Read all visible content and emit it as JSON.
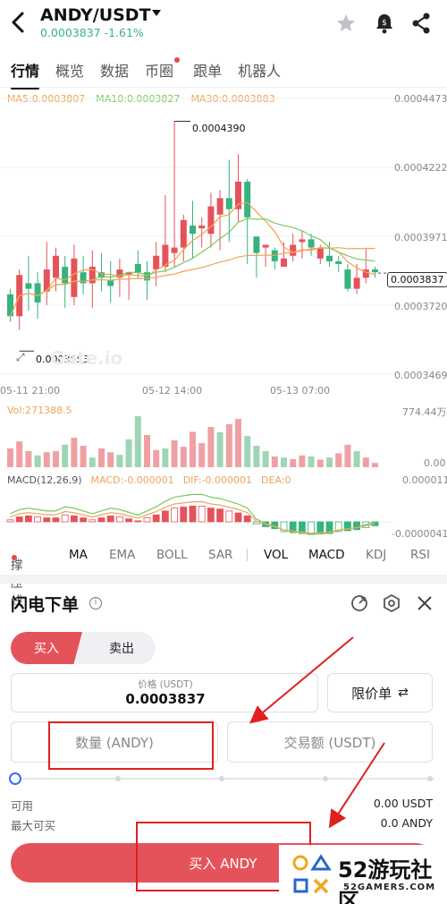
{
  "header": {
    "pair": "ANDY/USDT",
    "price_change": "0.0003837 -1.61%"
  },
  "tabs": [
    {
      "label": "行情"
    },
    {
      "label": "概览"
    },
    {
      "label": "数据"
    },
    {
      "label": "币圈"
    },
    {
      "label": "跟单"
    },
    {
      "label": "机器人"
    }
  ],
  "ma_legend": {
    "ma5": "MA5:0.0003807",
    "ma10": "MA10:0.0003827",
    "ma30": "MA30:0.0003883",
    "colors": {
      "ma5": "#f2a14d",
      "ma10": "#79c95f",
      "ma30": "#f0a35a"
    }
  },
  "chart_axis": {
    "y_labels": [
      "0.0004473",
      "0.0004222",
      "0.0003971",
      "0.0003720",
      "0.0003469"
    ],
    "x_labels": [
      "05-11 21:00",
      "05-12 14:00",
      "05-13 07:00"
    ],
    "current_price": "0.0003837",
    "high_label": "0.0004390",
    "low_label": "0.0003553",
    "watermark": "Gate.io"
  },
  "volume": {
    "label": "Vol:271388.5",
    "max_label": "774.44万",
    "zero_label": "0.00"
  },
  "macd": {
    "label": "MACD(12,26,9)",
    "macd_val": "MACD:-0.000001",
    "dif_val": "DIF:-0.000001",
    "dea_val": "DEA:0",
    "top_label": "0.0000112",
    "bottom_label": "-0.0000041"
  },
  "indicator_tabs": [
    "撑压线",
    "MA",
    "EMA",
    "BOLL",
    "SAR",
    "VOL",
    "MACD",
    "KDJ",
    "RSI"
  ],
  "order_panel": {
    "title": "闪电下单",
    "buy_tab": "买入",
    "sell_tab": "卖出",
    "price_label": "价格 (USDT)",
    "price_value": "0.0003837",
    "order_type": "限价单",
    "quantity_placeholder": "数量 (ANDY)",
    "amount_placeholder": "交易额 (USDT)",
    "available_label": "可用",
    "available_value": "0.00 USDT",
    "max_buy_label": "最大可买",
    "max_buy_value": "0.0 ANDY",
    "buy_button": "买入 ANDY"
  },
  "watermark_logo": {
    "big": "52游玩社区",
    "small": "52GAMERS.COM"
  },
  "chart_data": {
    "type": "candlestick",
    "ylim": [
      0.0003469,
      0.0004473
    ],
    "y_ticks": [
      0.0004473,
      0.0004222,
      0.0003971,
      0.000372,
      0.0003469
    ],
    "x_ticks": [
      "05-11 21:00",
      "05-12 14:00",
      "05-13 07:00"
    ],
    "candles": [
      [
        0.000376,
        0.000368,
        0.000378,
        0.000366
      ],
      [
        0.000368,
        0.000383,
        0.000385,
        0.000363
      ],
      [
        0.00038,
        0.000378,
        0.00039,
        0.00037
      ],
      [
        0.00038,
        0.000373,
        0.000384,
        0.000367
      ],
      [
        0.000377,
        0.000385,
        0.000395,
        0.000372
      ],
      [
        0.000382,
        0.00039,
        0.000393,
        0.000377
      ],
      [
        0.000386,
        0.00038,
        0.00039,
        0.000371
      ],
      [
        0.000375,
        0.000389,
        0.000394,
        0.000372
      ],
      [
        0.000384,
        0.00038,
        0.00039,
        0.000376
      ],
      [
        0.00038,
        0.000386,
        0.000392,
        0.000371
      ],
      [
        0.000384,
        0.000382,
        0.000391,
        0.000377
      ],
      [
        0.000381,
        0.000379,
        0.000388,
        0.000373
      ],
      [
        0.000382,
        0.000385,
        0.000389,
        0.000375
      ],
      [
        0.000383,
        0.000384,
        0.000384,
        0.000374
      ],
      [
        0.000387,
        0.000384,
        0.000392,
        0.000382
      ],
      [
        0.000384,
        0.000381,
        0.000388,
        0.000374
      ],
      [
        0.000385,
        0.00039,
        0.000395,
        0.000379
      ],
      [
        0.000386,
        0.000394,
        0.000412,
        0.000384
      ],
      [
        0.000391,
        0.000393,
        0.000439,
        0.000386
      ],
      [
        0.000393,
        0.000403,
        0.000405,
        0.000388
      ],
      [
        0.000401,
        0.000398,
        0.00041,
        0.000389
      ],
      [
        0.0004,
        0.000401,
        0.000404,
        0.000393
      ],
      [
        0.000398,
        0.000408,
        0.000413,
        0.000393
      ],
      [
        0.000405,
        0.000411,
        0.000414,
        0.000392
      ],
      [
        0.000411,
        0.000407,
        0.000425,
        0.000395
      ],
      [
        0.000407,
        0.000417,
        0.000427,
        0.000402
      ],
      [
        0.000417,
        0.000404,
        0.000418,
        0.000387
      ],
      [
        0.000397,
        0.000391,
        0.000397,
        0.000382
      ],
      [
        0.000393,
        0.000394,
        0.000394,
        0.000386
      ],
      [
        0.000392,
        0.000388,
        0.000393,
        0.000385
      ],
      [
        0.000386,
        0.000389,
        0.000395,
        0.000387
      ],
      [
        0.00039,
        0.000394,
        0.000398,
        0.000388
      ],
      [
        0.000395,
        0.000396,
        0.000399,
        0.000389
      ],
      [
        0.000396,
        0.000393,
        0.000398,
        0.00039
      ],
      [
        0.000389,
        0.000393,
        0.000394,
        0.000387
      ],
      [
        0.00039,
        0.000388,
        0.000395,
        0.000386
      ],
      [
        0.000388,
        0.000387,
        0.00039,
        0.000384
      ],
      [
        0.000385,
        0.000378,
        0.000387,
        0.000377
      ],
      [
        0.000378,
        0.000382,
        0.000387,
        0.000376
      ],
      [
        0.000382,
        0.000385,
        0.000393,
        0.00038
      ],
      [
        0.000385,
        0.000384,
        0.000386,
        0.000382
      ]
    ],
    "volume_max": 7744400,
    "volume_bars": [
      [
        0.35,
        "u"
      ],
      [
        0.48,
        "u"
      ],
      [
        0.3,
        "u"
      ],
      [
        0.22,
        "d"
      ],
      [
        0.28,
        "u"
      ],
      [
        0.3,
        "u"
      ],
      [
        0.42,
        "d"
      ],
      [
        0.55,
        "u"
      ],
      [
        0.4,
        "u"
      ],
      [
        0.18,
        "d"
      ],
      [
        0.35,
        "u"
      ],
      [
        0.28,
        "u"
      ],
      [
        0.23,
        "d"
      ],
      [
        0.52,
        "d"
      ],
      [
        0.95,
        "d"
      ],
      [
        0.6,
        "u"
      ],
      [
        0.32,
        "u"
      ],
      [
        0.35,
        "d"
      ],
      [
        0.5,
        "u"
      ],
      [
        0.38,
        "u"
      ],
      [
        0.66,
        "u"
      ],
      [
        0.45,
        "u"
      ],
      [
        0.75,
        "u"
      ],
      [
        0.65,
        "d"
      ],
      [
        0.8,
        "u"
      ],
      [
        0.9,
        "u"
      ],
      [
        0.58,
        "d"
      ],
      [
        0.4,
        "d"
      ],
      [
        0.3,
        "d"
      ],
      [
        0.2,
        "u"
      ],
      [
        0.18,
        "d"
      ],
      [
        0.15,
        "u"
      ],
      [
        0.22,
        "u"
      ],
      [
        0.2,
        "d"
      ],
      [
        0.14,
        "u"
      ],
      [
        0.18,
        "d"
      ],
      [
        0.26,
        "u"
      ],
      [
        0.42,
        "u"
      ],
      [
        0.3,
        "d"
      ],
      [
        0.18,
        "u"
      ],
      [
        0.08,
        "u"
      ]
    ],
    "macd_hist": [
      0.1,
      0.25,
      0.3,
      0.25,
      0.2,
      0.2,
      0.35,
      0.3,
      0.2,
      0.1,
      0.2,
      0.3,
      0.25,
      0.15,
      0.05,
      0.2,
      0.35,
      0.55,
      0.7,
      0.75,
      0.8,
      0.8,
      0.7,
      0.65,
      0.55,
      0.45,
      0.3,
      -0.1,
      -0.25,
      -0.35,
      -0.5,
      -0.55,
      -0.6,
      -0.65,
      -0.62,
      -0.6,
      -0.5,
      -0.45,
      -0.4,
      -0.3,
      -0.2
    ]
  }
}
